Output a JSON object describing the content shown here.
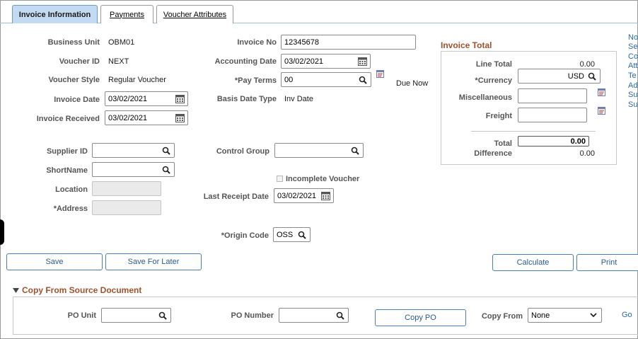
{
  "tabs": [
    {
      "label": "Invoice Information"
    },
    {
      "label": "Payments"
    },
    {
      "label": "Voucher Attributes"
    }
  ],
  "header": {
    "business_unit_label": "Business Unit",
    "business_unit": "OBM01",
    "voucher_id_label": "Voucher ID",
    "voucher_id": "NEXT",
    "voucher_style_label": "Voucher Style",
    "voucher_style": "Regular Voucher",
    "invoice_date_label": "Invoice Date",
    "invoice_date": "03/02/2021",
    "invoice_received_label": "Invoice Received",
    "invoice_received": "03/02/2021",
    "invoice_no_label": "Invoice No",
    "invoice_no": "12345678",
    "accounting_date_label": "Accounting Date",
    "accounting_date": "03/02/2021",
    "pay_terms_label": "*Pay Terms",
    "pay_terms": "00",
    "pay_terms_desc": "Due Now",
    "basis_date_type_label": "Basis Date Type",
    "basis_date_type": "Inv Date"
  },
  "supplier": {
    "supplier_id_label": "Supplier ID",
    "supplier_id": "",
    "shortname_label": "ShortName",
    "shortname": "",
    "location_label": "Location",
    "location": "",
    "address_label": "*Address",
    "address": "",
    "control_group_label": "Control Group",
    "control_group": "",
    "incomplete_voucher_label": "Incomplete Voucher",
    "last_receipt_date_label": "Last Receipt Date",
    "last_receipt_date": "03/02/2021",
    "origin_code_label": "*Origin Code",
    "origin_code": "OSS"
  },
  "invoice_total": {
    "title": "Invoice Total",
    "line_total_label": "Line Total",
    "line_total": "0.00",
    "currency_label": "*Currency",
    "currency": "USD",
    "misc_label": "Miscellaneous",
    "misc": "",
    "freight_label": "Freight",
    "freight": "",
    "total_label": "Total",
    "total": "0.00",
    "difference_label": "Difference",
    "difference": "0.00"
  },
  "side_links": [
    "No",
    "Se",
    "Co",
    "Att",
    "Te",
    "Ad",
    "Su",
    "Su"
  ],
  "buttons": {
    "save": "Save",
    "save_for_later": "Save For Later",
    "calculate": "Calculate",
    "print": "Print"
  },
  "copy_from": {
    "title": "Copy From Source Document",
    "po_unit_label": "PO Unit",
    "po_unit": "",
    "po_number_label": "PO Number",
    "po_number": "",
    "copy_po_label": "Copy PO",
    "copy_from_label": "Copy From",
    "copy_from_value": "None",
    "go_label": "Go"
  },
  "colors": {
    "active_tab_bg": "#c3daf3",
    "section_title": "#a0522d",
    "link": "#2a6aa8",
    "button_text": "#2a5a8c"
  }
}
